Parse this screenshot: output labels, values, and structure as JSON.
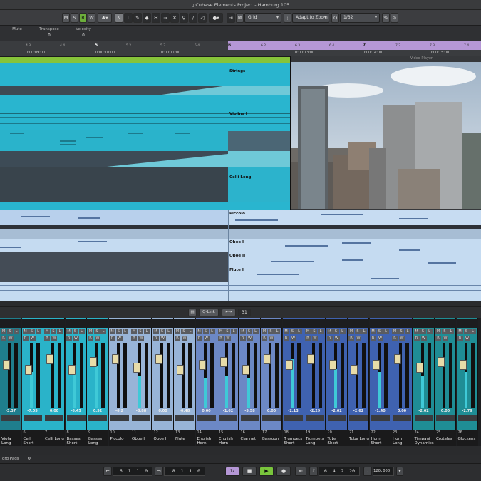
{
  "title": "Cubase Elements Project - Hamburg 105",
  "toolbar": {
    "m": "M",
    "s": "S",
    "r": "R",
    "w": "W",
    "grid_label": "Grid",
    "zoom_label": "Adapt to Zoom",
    "quantize": "1/32"
  },
  "infoline": {
    "mute_label": "Mute",
    "mute_value": "",
    "transpose_label": "Transpose",
    "transpose_value": "0",
    "velocity_label": "Velocity",
    "velocity_value": "0"
  },
  "ruler": {
    "bars": [
      {
        "n": "4",
        "beats": [
          "4.3",
          "4.4"
        ]
      },
      {
        "n": "5",
        "beats": [
          "5.2",
          "5.3",
          "5.4"
        ]
      },
      {
        "n": "6",
        "beats": [
          "6.2",
          "6.3",
          "6.4"
        ]
      },
      {
        "n": "7",
        "beats": [
          "7.2",
          "7.3",
          "7.4"
        ]
      }
    ],
    "timecodes": [
      "0:00:09:00",
      "0:00:10:00",
      "0:00:11:00",
      "0:00:13:00",
      "0:00:14:00",
      "0:00:15:00"
    ]
  },
  "parts": [
    "Strings",
    "Violins I",
    "Celli Long",
    "Piccolo",
    "Oboe I",
    "Oboe II",
    "Flute I"
  ],
  "video_title": "Video Player",
  "mixer_bar": {
    "qlink": "Q-Link",
    "count": "31"
  },
  "channels": [
    {
      "num": "",
      "name": "Viola Long",
      "val": "-3.37",
      "fill": 0.0,
      "cap": 0.3
    },
    {
      "num": "6",
      "name": "Celli Short",
      "val": "-7.05",
      "fill": 0.55,
      "cap": 0.4
    },
    {
      "num": "7",
      "name": "Celli Long",
      "val": "0.00",
      "fill": 0.0,
      "cap": 0.2
    },
    {
      "num": "8",
      "name": "Basses Short",
      "val": "-6.45",
      "fill": 0.6,
      "cap": 0.4
    },
    {
      "num": "9",
      "name": "Basses Long",
      "val": "0.52",
      "fill": 0.65,
      "cap": 0.25
    },
    {
      "num": "10",
      "name": "Piccolo",
      "val": "-6.2",
      "fill": 0.0,
      "cap": 0.2
    },
    {
      "num": "11",
      "name": "Oboe I",
      "val": "-8.88",
      "fill": 0.5,
      "cap": 0.35
    },
    {
      "num": "12",
      "name": "Oboe II",
      "val": "0.00",
      "fill": 0.0,
      "cap": 0.2
    },
    {
      "num": "13",
      "name": "Flute I",
      "val": "-6.48",
      "fill": 0.0,
      "cap": 0.4
    },
    {
      "num": "14",
      "name": "English Horn",
      "val": "0.00",
      "fill": 0.45,
      "cap": 0.3
    },
    {
      "num": "15",
      "name": "English Horn",
      "val": "-1.62",
      "fill": 0.5,
      "cap": 0.25
    },
    {
      "num": "16",
      "name": "Clarinet",
      "val": "-5.58",
      "fill": 0.45,
      "cap": 0.4
    },
    {
      "num": "17",
      "name": "Bassoon",
      "val": "0.00",
      "fill": 0.0,
      "cap": 0.2
    },
    {
      "num": "18",
      "name": "Trumpets Short",
      "val": "-2.13",
      "fill": 0.75,
      "cap": 0.3
    },
    {
      "num": "19",
      "name": "Trumpets Long",
      "val": "-2.29",
      "fill": 0.0,
      "cap": 0.2
    },
    {
      "num": "20",
      "name": "Tuba Short",
      "val": "-2.62",
      "fill": 0.6,
      "cap": 0.3
    },
    {
      "num": "21",
      "name": "Tuba Long",
      "val": "-2.62",
      "fill": 0.0,
      "cap": 0.4
    },
    {
      "num": "22",
      "name": "Horn Short",
      "val": "-1.40",
      "fill": 0.55,
      "cap": 0.3
    },
    {
      "num": "23",
      "name": "Horn Long",
      "val": "0.00",
      "fill": 0.0,
      "cap": 0.2
    },
    {
      "num": "24",
      "name": "Timpani Dynamics",
      "val": "-2.62",
      "fill": 0.5,
      "cap": 0.35
    },
    {
      "num": "25",
      "name": "Crotales",
      "val": "0.00",
      "fill": 0.0,
      "cap": 0.25
    },
    {
      "num": "26",
      "name": "Glockens",
      "val": "-2.79",
      "fill": 0.55,
      "cap": 0.3
    }
  ],
  "statusbar": {
    "label": "ord Pads"
  },
  "transport": {
    "left_locator": "6. 1. 1.  0",
    "right_locator": "8. 1. 1.  0",
    "position": "6. 4. 2. 20",
    "tempo": "120.000"
  },
  "colors": {
    "accent": "#27aec9",
    "marker": "#86c43a",
    "loop": "#b597d6",
    "lower": "#c5dbf1",
    "cap": "#e8dca8"
  }
}
